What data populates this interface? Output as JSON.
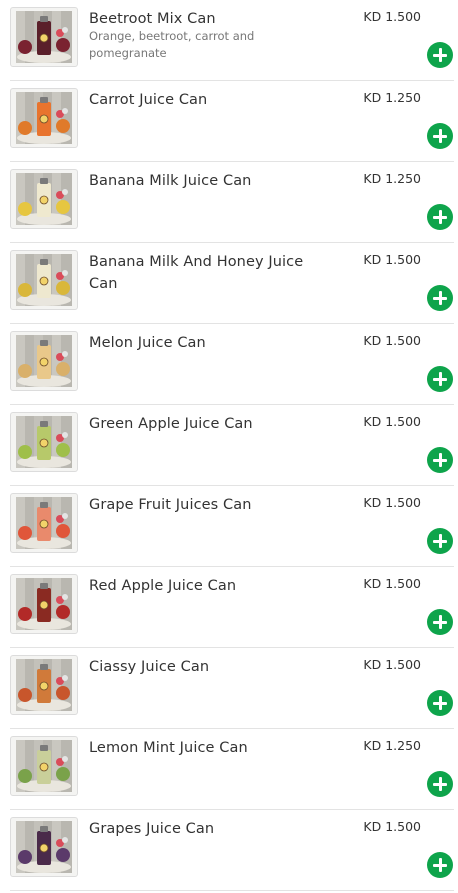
{
  "products": [
    {
      "name": "Beetroot Mix Can",
      "description": "Orange, beetroot, carrot and pomegranate",
      "price": "KD 1.500",
      "color": "#5a1f2a",
      "fruit": "#7a2230"
    },
    {
      "name": "Carrot Juice Can",
      "description": "",
      "price": "KD 1.250",
      "color": "#e8742e",
      "fruit": "#e07a2a"
    },
    {
      "name": "Banana Milk Juice Can",
      "description": "",
      "price": "KD 1.250",
      "color": "#efe9cf",
      "fruit": "#e6c640"
    },
    {
      "name": "Banana Milk And Honey Juice Can",
      "description": "",
      "price": "KD 1.500",
      "color": "#eee8cf",
      "fruit": "#d9b73a"
    },
    {
      "name": "Melon Juice Can",
      "description": "",
      "price": "KD 1.500",
      "color": "#e9c88a",
      "fruit": "#d9b06a"
    },
    {
      "name": "Green Apple Juice Can",
      "description": "",
      "price": "KD 1.500",
      "color": "#b7c96a",
      "fruit": "#9fbf4a"
    },
    {
      "name": "Grape Fruit Juices Can",
      "description": "",
      "price": "KD 1.500",
      "color": "#e98a6c",
      "fruit": "#e0563a"
    },
    {
      "name": "Red Apple Juice Can",
      "description": "",
      "price": "KD 1.500",
      "color": "#8a2a22",
      "fruit": "#b22a28"
    },
    {
      "name": "Ciassy Juice Can",
      "description": "",
      "price": "KD 1.500",
      "color": "#d07a3a",
      "fruit": "#c8562c"
    },
    {
      "name": "Lemon Mint Juice Can",
      "description": "",
      "price": "KD 1.250",
      "color": "#c9cf9a",
      "fruit": "#7aa24a"
    },
    {
      "name": "Grapes Juice Can",
      "description": "",
      "price": "KD 1.500",
      "color": "#4a2a4a",
      "fruit": "#5b3a6a"
    }
  ],
  "colors": {
    "accent": "#0ea44b",
    "divider": "#e3e3e3"
  },
  "icons": {
    "add": "plus-circle-icon"
  }
}
